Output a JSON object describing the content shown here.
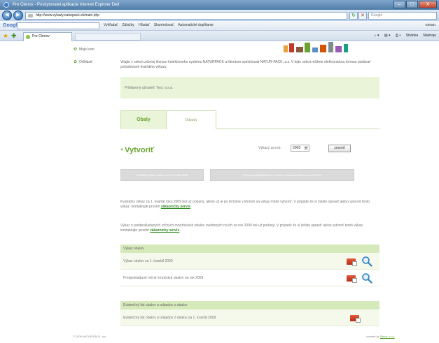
{
  "window": {
    "title": "Pre Clenov - Poskytovatel aplikacie Internet Explorer Dell",
    "minimize": "–",
    "maximize": "□",
    "close": "X"
  },
  "address_bar": {
    "back": "◀",
    "forward": "▶",
    "url": "http://www.vykazy.naturpack.sk/main.php",
    "refresh": "↻",
    "stop": "✕",
    "search_placeholder": "Google"
  },
  "google_toolbar": {
    "logo": "Google",
    "search_button": "Vyhľadať",
    "items": [
      "Záložky",
      "Hľadať",
      "Skontrolovať",
      "Automatické dopĺňanie"
    ],
    "user": "roman."
  },
  "favorites_bar": {
    "tab_title": "Pre Clenov",
    "commands": [
      "Stránka",
      "Nástroje"
    ]
  },
  "sidebar": {
    "items": [
      {
        "label": "Moje kont"
      },
      {
        "label": "Odhlásiť"
      }
    ]
  },
  "main": {
    "intro": "Vitajte v sekcii určenej členom kolektívneho systému NATURPACK a klientom spoločnosti NATUR-PACK, a.s. V tejto sekcii môžete elektronickou formou podávať požadované kvartálne výkazy.",
    "login_info": "Prihlásený užívateľ: Test, a.s.a.",
    "tabs": {
      "active": "Obaly",
      "inactive": "Odpady"
    },
    "create_label": "Vytvoriť",
    "create_plus": "+",
    "year_label": "Výkazy za rok:",
    "year_value": "2009",
    "change_button": "zmeniť",
    "disabled_buttons": [
      "Kvartálny výkaz obalov za 3. kvartál 2009",
      "Výkaz predpokladaného ročného množstva obalov na rok 2009"
    ],
    "para1_text": "Kvartálny výkaz za 1. kvartál roku 2009 bol už podaný, alebo už je po termíne v ktorom sa výkaz môže vytvoriť. V prípade že si želáte opraviť alebo vytvoriť tento výkaz, kontaktujte prosím",
    "para1_link": "zákaznícky servis",
    "para1_end": ".",
    "para2_text": "Výkaz o predpokladaných ročných množstvách obalov uvedených na trh za rok 2009 bol už podaný. V prípade že si želáte opraviť alebo vytvoriť tento výkaz, kontaktujte prosím",
    "para2_link": "zákaznícky servis",
    "para2_end": "."
  },
  "sections": [
    {
      "title": "Výkaz obalov",
      "rows": [
        {
          "label": "Výkaz obalov za 1. kvartál 2009"
        },
        {
          "label": "Predpokladané ročné množstvá obalov na rok 2009"
        }
      ]
    },
    {
      "title": "Evidenčný list obalov a odpadov z obalov",
      "rows": [
        {
          "label": "Evidenčný list obalov a odpadov z obalov za 1. kvartál 2009"
        }
      ]
    }
  ],
  "footer": {
    "copyright": "© 2009 NATUR-PACK, a.s.",
    "created_by": "created by",
    "created_link": "Sieos, s.r.o."
  },
  "colors": {
    "accent_green": "#6aa330",
    "panel_green": "#e9f4d9",
    "header_green": "#d6e9ba",
    "pdf_red": "#c8381f",
    "window_blue": "#4f7ba6"
  }
}
